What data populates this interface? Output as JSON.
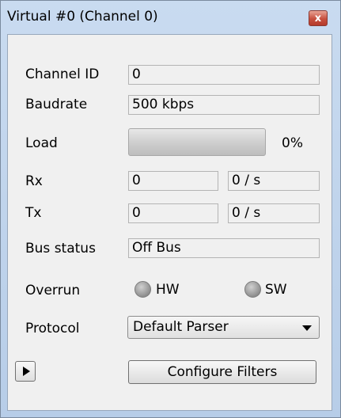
{
  "window": {
    "title": "Virtual #0 (Channel 0)",
    "close_label": "x"
  },
  "channel_id": {
    "label": "Channel ID",
    "value": "0"
  },
  "baudrate": {
    "label": "Baudrate",
    "value": "500 kbps"
  },
  "load": {
    "label": "Load",
    "value_text": "0%",
    "fraction": 0
  },
  "rx": {
    "label": "Rx",
    "count": "0",
    "rate": "0 / s"
  },
  "tx": {
    "label": "Tx",
    "count": "0",
    "rate": "0 / s"
  },
  "bus_status": {
    "label": "Bus status",
    "value": "Off Bus"
  },
  "overrun": {
    "label": "Overrun",
    "hw_label": "HW",
    "sw_label": "SW",
    "led_color": "#9a9a9a"
  },
  "protocol": {
    "label": "Protocol",
    "selected": "Default Parser"
  },
  "actions": {
    "play_icon": "play-icon",
    "configure_filters_label": "Configure Filters"
  }
}
